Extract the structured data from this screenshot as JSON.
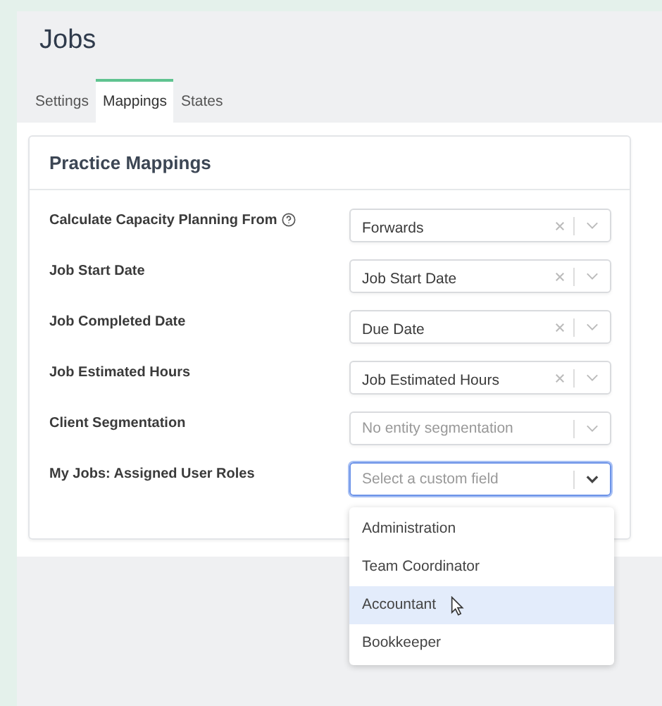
{
  "page": {
    "title": "Jobs"
  },
  "tabs": [
    {
      "label": "Settings",
      "selected": false
    },
    {
      "label": "Mappings",
      "selected": true
    },
    {
      "label": "States",
      "selected": false
    }
  ],
  "card": {
    "title": "Practice Mappings"
  },
  "fields": [
    {
      "label": "Calculate Capacity Planning From",
      "help": true,
      "value": "Forwards",
      "clearable": true,
      "open": false
    },
    {
      "label": "Job Start Date",
      "help": false,
      "value": "Job Start Date",
      "clearable": true,
      "open": false
    },
    {
      "label": "Job Completed Date",
      "help": false,
      "value": "Due Date",
      "clearable": true,
      "open": false
    },
    {
      "label": "Job Estimated Hours",
      "help": false,
      "value": "Job Estimated Hours",
      "clearable": true,
      "open": false
    },
    {
      "label": "Client Segmentation",
      "help": false,
      "placeholder": "No entity segmentation",
      "clearable": false,
      "open": false
    },
    {
      "label": "My Jobs: Assigned User Roles",
      "help": false,
      "placeholder": "Select a custom field",
      "clearable": false,
      "open": true
    }
  ],
  "menu": [
    {
      "label": "Administration",
      "selected": false
    },
    {
      "label": "Team Coordinator",
      "selected": false
    },
    {
      "label": "Accountant",
      "selected": true
    },
    {
      "label": "Bookkeeper",
      "selected": false
    }
  ]
}
